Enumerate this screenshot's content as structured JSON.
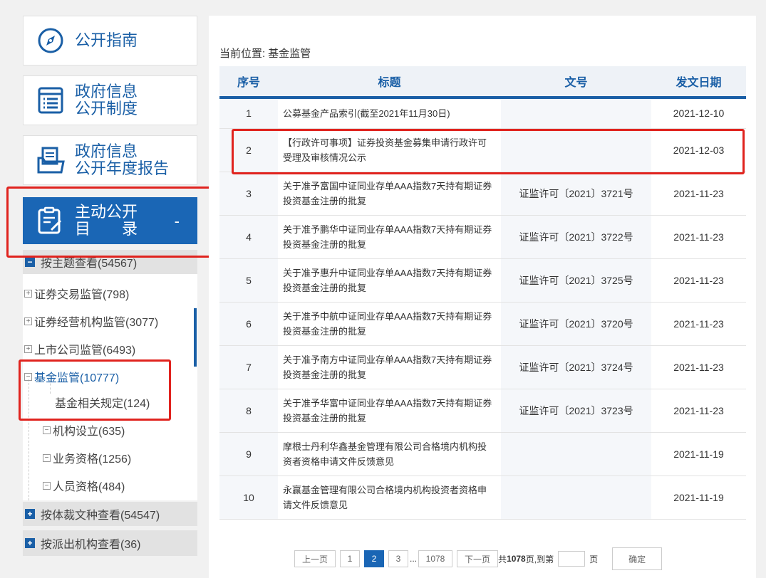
{
  "sidebar": {
    "guide": "公开指南",
    "system_l1": "政府信息",
    "system_l2": "公开制度",
    "report_l1": "政府信息",
    "report_l2": "公开年度报告",
    "active_l1": "主动公开",
    "active_l2": "目　　录",
    "active_toggle": "-",
    "tree_headers": [
      "按主题查看(54567)",
      "按体裁文种查看(54547)",
      "按派出机构查看(36)"
    ],
    "tree_nodes": [
      "证券交易监管(798)",
      "证券经营机构监管(3077)",
      "上市公司监管(6493)",
      "基金监管(10777)",
      "基金相关规定(124)",
      "机构设立(635)",
      "业务资格(1256)",
      "人员资格(484)"
    ]
  },
  "main": {
    "crumb_label": "当前位置:",
    "crumb_value": "基金监管",
    "columns": [
      "序号",
      "标题",
      "文号",
      "发文日期"
    ],
    "rows": [
      {
        "n": "1",
        "title": "公募基金产品索引(截至2021年11月30日)",
        "doc": "",
        "date": "2021-12-10"
      },
      {
        "n": "2",
        "title": "【行政许可事项】证券投资基金募集申请行政许可受理及审核情况公示",
        "doc": "",
        "date": "2021-12-03"
      },
      {
        "n": "3",
        "title": "关于准予富国中证同业存单AAA指数7天持有期证券投资基金注册的批复",
        "doc": "证监许可〔2021〕3721号",
        "date": "2021-11-23"
      },
      {
        "n": "4",
        "title": "关于准予鹏华中证同业存单AAA指数7天持有期证券投资基金注册的批复",
        "doc": "证监许可〔2021〕3722号",
        "date": "2021-11-23"
      },
      {
        "n": "5",
        "title": "关于准予惠升中证同业存单AAA指数7天持有期证券投资基金注册的批复",
        "doc": "证监许可〔2021〕3725号",
        "date": "2021-11-23"
      },
      {
        "n": "6",
        "title": "关于准予中航中证同业存单AAA指数7天持有期证券投资基金注册的批复",
        "doc": "证监许可〔2021〕3720号",
        "date": "2021-11-23"
      },
      {
        "n": "7",
        "title": "关于准予南方中证同业存单AAA指数7天持有期证券投资基金注册的批复",
        "doc": "证监许可〔2021〕3724号",
        "date": "2021-11-23"
      },
      {
        "n": "8",
        "title": "关于准予华富中证同业存单AAA指数7天持有期证券投资基金注册的批复",
        "doc": "证监许可〔2021〕3723号",
        "date": "2021-11-23"
      },
      {
        "n": "9",
        "title": "摩根士丹利华鑫基金管理有限公司合格境内机构投资者资格申请文件反馈意见",
        "doc": "",
        "date": "2021-11-19"
      },
      {
        "n": "10",
        "title": "永赢基金管理有限公司合格境内机构投资者资格申请文件反馈意见",
        "doc": "",
        "date": "2021-11-19"
      }
    ]
  },
  "pager": {
    "prev": "上一页",
    "pages": [
      "1",
      "2",
      "3"
    ],
    "ellipsis": "...",
    "last": "1078",
    "next": "下一页",
    "total_prefix": "共",
    "total": "1078",
    "total_suffix": "页,到第",
    "page_suffix": "页",
    "confirm": "确定"
  },
  "colors": {
    "accent": "#1a66b5",
    "highlight": "#e0231e"
  }
}
